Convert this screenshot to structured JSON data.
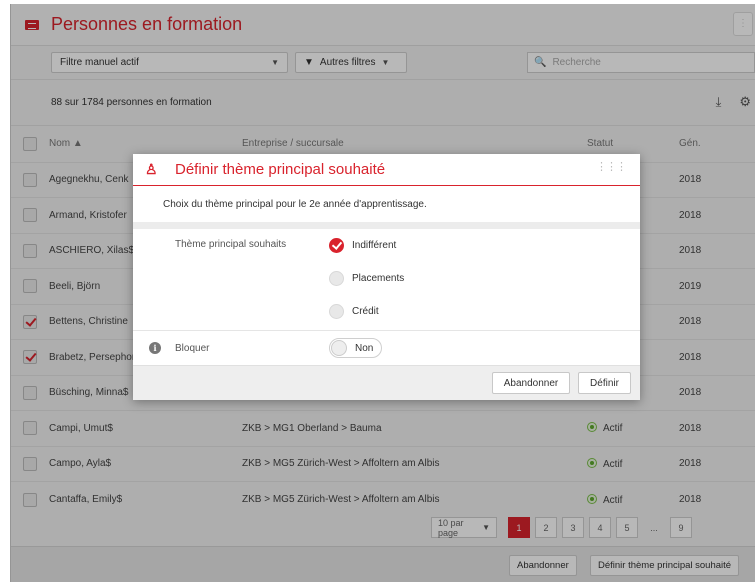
{
  "window": {
    "title": "Personnes en formation"
  },
  "filters": {
    "manual_label": "Filtre manuel actif",
    "other_filters_label": "Autres filtres",
    "search_placeholder": "Recherche"
  },
  "info": {
    "count_text": "88 sur 1784 personnes en formation"
  },
  "table": {
    "columns": [
      "Nom ▲",
      "Entreprise / succursale",
      "Statut",
      "Gén."
    ],
    "rows": [
      {
        "name": "Agegnekhu, Cenk",
        "company": "",
        "status": "",
        "gen": "2018",
        "checked": false
      },
      {
        "name": "Armand, Kristofer",
        "company": "",
        "status": "",
        "gen": "2018",
        "checked": false
      },
      {
        "name": "ASCHIERO, Xilas$",
        "company": "",
        "status": "",
        "gen": "2018",
        "checked": false
      },
      {
        "name": "Beeli, Björn",
        "company": "",
        "status": "",
        "gen": "2019",
        "checked": false
      },
      {
        "name": "Bettens, Christine",
        "company": "",
        "status": "",
        "gen": "2018",
        "checked": true
      },
      {
        "name": "Brabetz, Persephon",
        "company": "",
        "status": "",
        "gen": "2018",
        "checked": true
      },
      {
        "name": "Büsching, Minna$",
        "company": "",
        "status": "",
        "gen": "2018",
        "checked": false
      },
      {
        "name": "Campi, Umut$",
        "company": "ZKB > MG1 Oberland > Bauma",
        "status": "Actif",
        "gen": "2018",
        "checked": false
      },
      {
        "name": "Campo, Ayla$",
        "company": "ZKB > MG5 Zürich-West > Affoltern am Albis",
        "status": "Actif",
        "gen": "2018",
        "checked": false
      },
      {
        "name": "Cantaffa, Emily$",
        "company": "ZKB > MG5 Zürich-West > Affoltern am Albis",
        "status": "Actif",
        "gen": "2018",
        "checked": false
      }
    ]
  },
  "pager": {
    "per_page": "10 par page",
    "pages": [
      "1",
      "2",
      "3",
      "4",
      "5",
      "...",
      "9"
    ],
    "active": "1"
  },
  "footer": {
    "cancel_label": "Abandonner",
    "define_label": "Définir thème principal souhaité"
  },
  "dialog": {
    "title": "Définir thème principal souhaité",
    "description": "Choix du thème principal pour le 2e année d'apprentissage.",
    "theme_label": "Thème principal souhaits",
    "options": [
      "Indifférent",
      "Placements",
      "Crédit"
    ],
    "selected": "Indifférent",
    "block_label": "Bloquer",
    "block_value": "Non",
    "cancel_label": "Abandonner",
    "define_label": "Définir"
  },
  "colors": {
    "accent": "#d9232d",
    "status_active": "#5ea82e"
  }
}
